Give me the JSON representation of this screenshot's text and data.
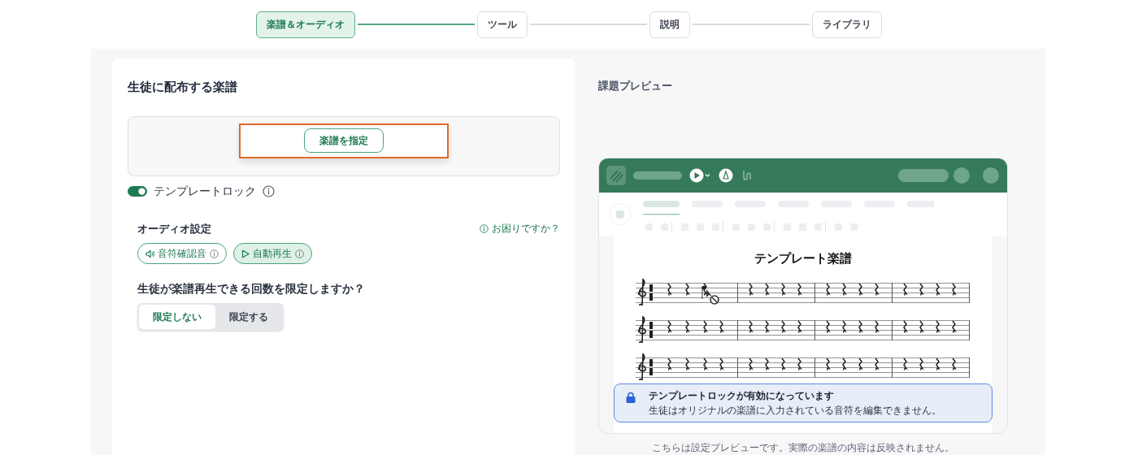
{
  "steps": [
    {
      "label": "楽譜＆オーディオ",
      "selected": true
    },
    {
      "label": "ツール",
      "selected": false
    },
    {
      "label": "説明",
      "selected": false
    },
    {
      "label": "ライブラリ",
      "selected": false
    }
  ],
  "score_card": {
    "title": "生徒に配布する楽譜",
    "select_button": "楽譜を指定",
    "highlighted": true
  },
  "template_lock": {
    "label": "テンプレートロック",
    "on": true
  },
  "audio": {
    "title": "オーディオ設定",
    "help": "お困りですか？",
    "options": [
      {
        "label": "音符確認音",
        "kind": "sound",
        "on": false
      },
      {
        "label": "自動再生",
        "kind": "play",
        "on": true
      }
    ]
  },
  "limit": {
    "question": "生徒が楽譜再生できる回数を限定しますか？",
    "choices": [
      {
        "label": "限定しない",
        "selected": true
      },
      {
        "label": "限定する",
        "selected": false
      }
    ]
  },
  "preview": {
    "title": "課題プレビュー",
    "score_title": "テンプレート楽譜",
    "lock_notice": {
      "title": "テンプレートロックが有効になっています",
      "body": "生徒はオリジナルの楽譜に入力されている音符を編集できません。"
    },
    "caption": "こちらは設定プレビューです。実際の楽譜の内容は反映されません。"
  }
}
